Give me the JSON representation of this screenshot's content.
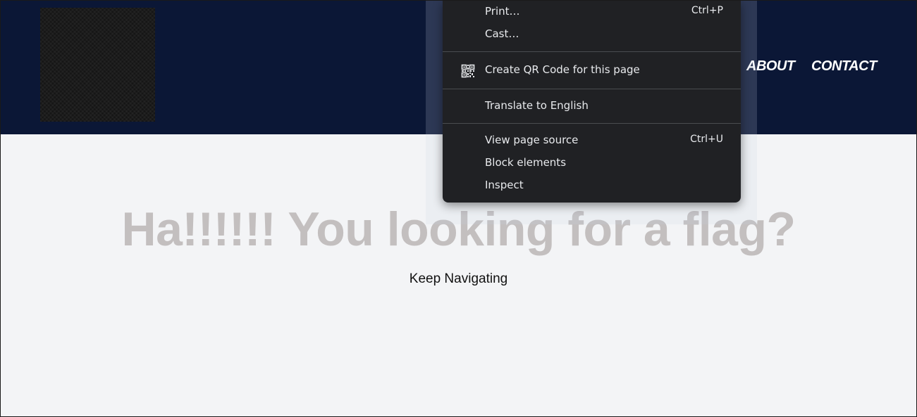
{
  "header": {
    "nav": {
      "about": "ABOUT",
      "contact": "CONTACT"
    },
    "background_color": "#0b1736"
  },
  "hero": {
    "title": "Ha!!!!!! You looking for a flag?",
    "subtitle": "Keep Navigating",
    "title_color": "#c3bfbf"
  },
  "context_menu": {
    "items": [
      {
        "label": "Print…",
        "shortcut": "Ctrl+P"
      },
      {
        "label": "Cast…",
        "shortcut": ""
      },
      {
        "label": "Create QR Code for this page",
        "shortcut": "",
        "icon": "qr-code-icon"
      },
      {
        "label": "Translate to English",
        "shortcut": ""
      },
      {
        "label": "View page source",
        "shortcut": "Ctrl+U"
      },
      {
        "label": "Block elements",
        "shortcut": ""
      },
      {
        "label": "Inspect",
        "shortcut": ""
      }
    ],
    "background_color": "#202124"
  }
}
